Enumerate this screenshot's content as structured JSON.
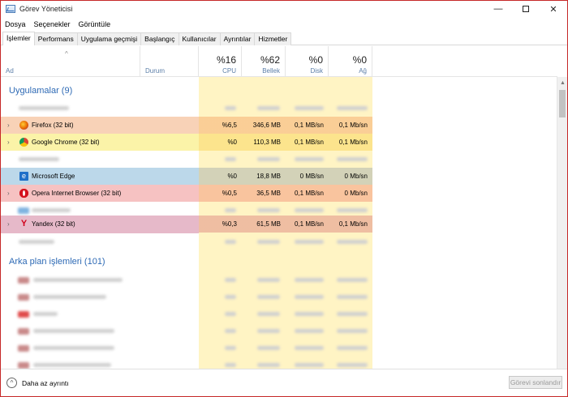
{
  "window": {
    "title": "Görev Yöneticisi"
  },
  "menu": [
    "Dosya",
    "Seçenekler",
    "Görüntüle"
  ],
  "tabs": [
    {
      "label": "İşlemler",
      "active": true
    },
    {
      "label": "Performans"
    },
    {
      "label": "Uygulama geçmişi"
    },
    {
      "label": "Başlangıç"
    },
    {
      "label": "Kullanıcılar"
    },
    {
      "label": "Ayrıntılar"
    },
    {
      "label": "Hizmetler"
    }
  ],
  "columns": {
    "name": "Ad",
    "status": "Durum",
    "cpu": {
      "label": "CPU",
      "pct": "%16"
    },
    "mem": {
      "label": "Bellek",
      "pct": "%62"
    },
    "disk": {
      "label": "Disk",
      "pct": "%0"
    },
    "net": {
      "label": "Ağ",
      "pct": "%0"
    }
  },
  "groups": {
    "apps": "Uygulamalar (9)",
    "background": "Arka plan işlemleri (101)"
  },
  "apps": [
    {
      "name": "Firefox (32 bit)",
      "cpu": "%6,5",
      "mem": "346,6 MB",
      "disk": "0,1 MB/sn",
      "net": "0,1 Mb/sn",
      "expander": "›",
      "icon": "firefox-icon"
    },
    {
      "name": "Google Chrome (32 bit)",
      "cpu": "%0",
      "mem": "110,3 MB",
      "disk": "0,1 MB/sn",
      "net": "0,1 Mb/sn",
      "expander": "›",
      "icon": "chrome-icon"
    },
    {
      "name": "Microsoft Edge",
      "cpu": "%0",
      "mem": "18,8 MB",
      "disk": "0 MB/sn",
      "net": "0 Mb/sn",
      "expander": "",
      "icon": "edge-icon"
    },
    {
      "name": "Opera Internet Browser (32 bit)",
      "cpu": "%0,5",
      "mem": "36,5 MB",
      "disk": "0,1 MB/sn",
      "net": "0 Mb/sn",
      "expander": "›",
      "icon": "opera-icon"
    },
    {
      "name": "Yandex (32 bit)",
      "cpu": "%0,3",
      "mem": "61,5 MB",
      "disk": "0,1 MB/sn",
      "net": "0,1 Mb/sn",
      "expander": "›",
      "icon": "yandex-icon"
    }
  ],
  "footer": {
    "fewer_details": "Daha az ayrıntı",
    "end_task": "Görevi sonlandır"
  },
  "colors": {
    "firefox": "#f8d2b7",
    "chrome": "#fbf3a8",
    "edge": "#bcd8ea",
    "opera": "#f6c2c2",
    "yandex": "#e6b9c9"
  }
}
